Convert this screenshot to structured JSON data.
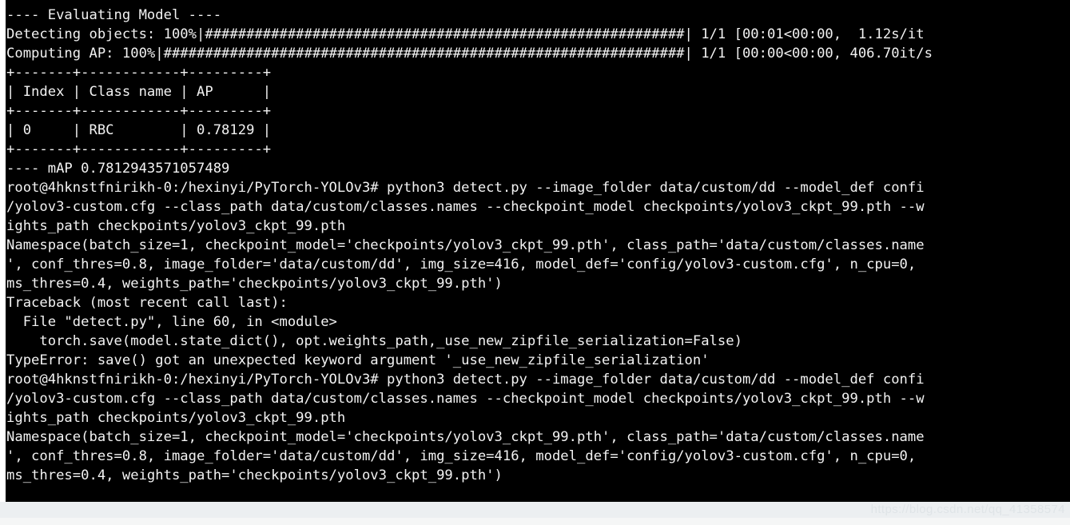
{
  "terminal": {
    "background_color": "#000000",
    "foreground_color": "#f2f2f2",
    "prompt": "root@4hknstfnirikh-0:/hexinyi/PyTorch-YOLOv3#",
    "lines": [
      "---- Evaluating Model ----",
      "Detecting objects: 100%|##########################################################| 1/1 [00:01<00:00,  1.12s/it",
      "Computing AP: 100%|###############################################################| 1/1 [00:00<00:00, 406.70it/s",
      "+-------+------------+---------+",
      "| Index | Class name | AP      |",
      "+-------+------------+---------+",
      "| 0     | RBC        | 0.78129 |",
      "+-------+------------+---------+",
      "---- mAP 0.7812943571057489",
      "root@4hknstfnirikh-0:/hexinyi/PyTorch-YOLOv3# python3 detect.py --image_folder data/custom/dd --model_def confi",
      "/yolov3-custom.cfg --class_path data/custom/classes.names --checkpoint_model checkpoints/yolov3_ckpt_99.pth --w",
      "ights_path checkpoints/yolov3_ckpt_99.pth",
      "Namespace(batch_size=1, checkpoint_model='checkpoints/yolov3_ckpt_99.pth', class_path='data/custom/classes.name",
      "', conf_thres=0.8, image_folder='data/custom/dd', img_size=416, model_def='config/yolov3-custom.cfg', n_cpu=0,",
      "ms_thres=0.4, weights_path='checkpoints/yolov3_ckpt_99.pth')",
      "Traceback (most recent call last):",
      "  File \"detect.py\", line 60, in <module>",
      "    torch.save(model.state_dict(), opt.weights_path,_use_new_zipfile_serialization=False)",
      "TypeError: save() got an unexpected keyword argument '_use_new_zipfile_serialization'",
      "root@4hknstfnirikh-0:/hexinyi/PyTorch-YOLOv3# python3 detect.py --image_folder data/custom/dd --model_def confi",
      "/yolov3-custom.cfg --class_path data/custom/classes.names --checkpoint_model checkpoints/yolov3_ckpt_99.pth --w",
      "ights_path checkpoints/yolov3_ckpt_99.pth",
      "Namespace(batch_size=1, checkpoint_model='checkpoints/yolov3_ckpt_99.pth', class_path='data/custom/classes.name",
      "', conf_thres=0.8, image_folder='data/custom/dd', img_size=416, model_def='config/yolov3-custom.cfg', n_cpu=0,",
      "ms_thres=0.4, weights_path='checkpoints/yolov3_ckpt_99.pth')"
    ],
    "evaluation": {
      "header": "---- Evaluating Model ----",
      "detecting_objects": {
        "label": "Detecting objects",
        "percent": "100%",
        "iterations": "1/1",
        "elapsed": "00:01",
        "remaining": "00:00",
        "rate": "1.12s/it"
      },
      "computing_ap": {
        "label": "Computing AP",
        "percent": "100%",
        "iterations": "1/1",
        "elapsed": "00:00",
        "remaining": "00:00",
        "rate": "406.70it/s"
      },
      "table": {
        "columns": [
          "Index",
          "Class name",
          "AP"
        ],
        "rows": [
          [
            "0",
            "RBC",
            "0.78129"
          ]
        ]
      },
      "map_label": "---- mAP",
      "map_value": "0.7812943571057489"
    },
    "error": {
      "traceback_header": "Traceback (most recent call last):",
      "file": "detect.py",
      "line_number": "60",
      "scope": "<module>",
      "source_line": "torch.save(model.state_dict(), opt.weights_path,_use_new_zipfile_serialization=False)",
      "exception_type": "TypeError",
      "message": "save() got an unexpected keyword argument '_use_new_zipfile_serialization'"
    },
    "namespace_args": {
      "batch_size": "1",
      "checkpoint_model": "checkpoints/yolov3_ckpt_99.pth",
      "class_path": "data/custom/classes.names",
      "conf_thres": "0.8",
      "image_folder": "data/custom/dd",
      "img_size": "416",
      "model_def": "config/yolov3-custom.cfg",
      "n_cpu": "0",
      "nms_thres": "0.4",
      "weights_path": "checkpoints/yolov3_ckpt_99.pth"
    }
  },
  "watermark": {
    "text": "https://blog.csdn.net/qq_41358574",
    "color": "#dfe4e7"
  }
}
